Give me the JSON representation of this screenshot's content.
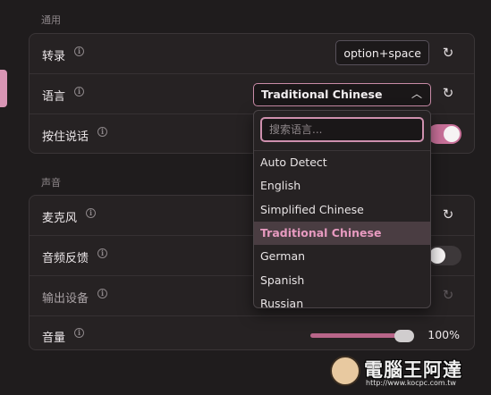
{
  "general": {
    "section_title": "通用",
    "transcribe": {
      "label": "转录",
      "hotkey": "option+space"
    },
    "language": {
      "label": "语言",
      "selected": "Traditional Chinese"
    },
    "push_to_talk": {
      "label": "按住说话"
    }
  },
  "sound": {
    "section_title": "声音",
    "microphone": {
      "label": "麦克风"
    },
    "audio_feedback": {
      "label": "音频反馈"
    },
    "output_device": {
      "label": "输出设备"
    },
    "volume": {
      "label": "音量",
      "value_text": "100%",
      "value": 1.0
    }
  },
  "language_dropdown": {
    "search_placeholder": "搜索语言...",
    "options": [
      "Auto Detect",
      "English",
      "Simplified Chinese",
      "Traditional Chinese",
      "German",
      "Spanish",
      "Russian"
    ],
    "selected_index": 3
  },
  "watermark": {
    "text": "電腦王阿達",
    "url": "http://www.kocpc.com.tw"
  },
  "colors": {
    "accent": "#c9719a",
    "selected_text": "#e79ac0"
  }
}
